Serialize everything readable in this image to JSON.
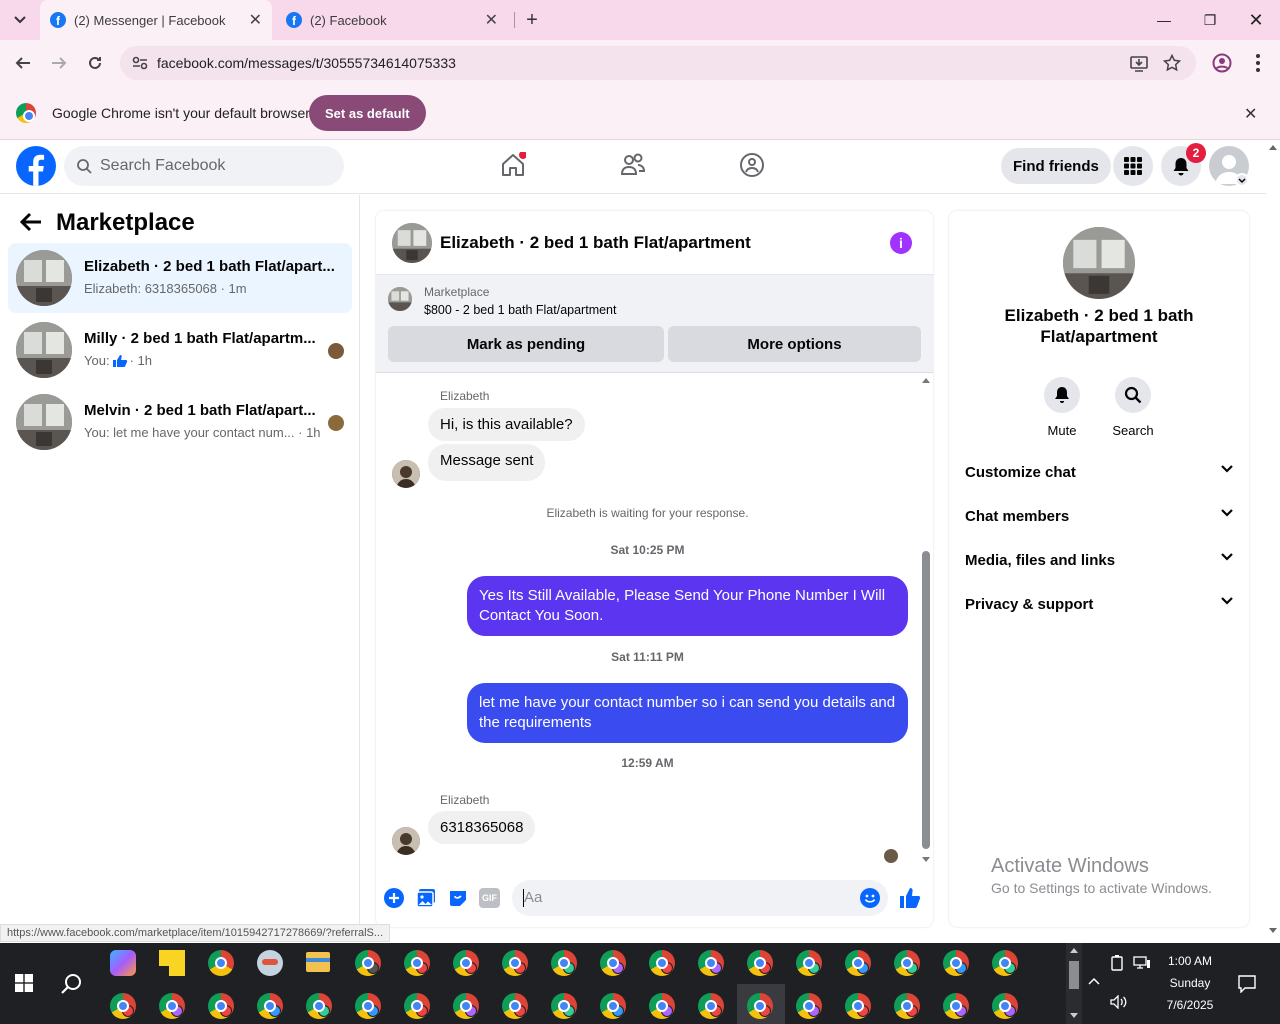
{
  "browser": {
    "tabs": [
      {
        "title": "(2) Messenger | Facebook",
        "active": true
      },
      {
        "title": "(2) Facebook",
        "active": false
      }
    ],
    "url": "facebook.com/messages/t/30555734614075333",
    "infobar_message": "Google Chrome isn't your default browser",
    "infobar_button": "Set as default",
    "status_url": "https://www.facebook.com/marketplace/item/1015942717278669/?referralS..."
  },
  "fb": {
    "search_placeholder": "Search Facebook",
    "find_friends": "Find friends",
    "notification_count": "2"
  },
  "sidebar": {
    "title": "Marketplace",
    "threads": [
      {
        "name": "Elizabeth · 2 bed 1 bath Flat/apart...",
        "preview": "Elizabeth: 6318365068 · 1m",
        "selected": true
      },
      {
        "name": "Milly · 2 bed 1 bath Flat/apartm...",
        "preview_prefix": "You: ",
        "preview_suffix": " · 1h",
        "selected": false
      },
      {
        "name": "Melvin · 2 bed 1 bath Flat/apart...",
        "preview": "You: let me have your contact num... · 1h",
        "selected": false
      }
    ]
  },
  "chat": {
    "title": "Elizabeth · 2 bed 1 bath Flat/apartment",
    "marketplace_label": "Marketplace",
    "listing": "$800 - 2 bed 1 bath Flat/apartment",
    "btn_pending": "Mark as pending",
    "btn_more": "More options",
    "messages": {
      "sender1": "Elizabeth",
      "m1": "Hi, is this available?",
      "m2": "Message sent",
      "waiting": "Elizabeth is waiting for your response.",
      "ts1": "Sat 10:25 PM",
      "out1": "Yes Its Still Available, Please Send Your Phone Number I Will Contact You Soon.",
      "ts2": "Sat 11:11 PM",
      "out2": "let me have your contact number so i can send you details and the requirements",
      "ts3": "12:59 AM",
      "sender2": "Elizabeth",
      "m3": "6318365068"
    },
    "input_placeholder": "Aa"
  },
  "details": {
    "name": "Elizabeth · 2 bed 1 bath Flat/apartment",
    "mute": "Mute",
    "search": "Search",
    "rows": [
      "Customize chat",
      "Chat members",
      "Media, files and links",
      "Privacy & support"
    ]
  },
  "watermark": {
    "line1": "Activate Windows",
    "line2": "Go to Settings to activate Windows."
  },
  "taskbar": {
    "time": "1:00 AM",
    "day": "Sunday",
    "date": "7/6/2025"
  },
  "colors": {
    "fb_blue": "#0866ff",
    "outgoing1": "#5b35f0",
    "outgoing2": "#3a4cf0",
    "badge": "#e41e3f"
  }
}
